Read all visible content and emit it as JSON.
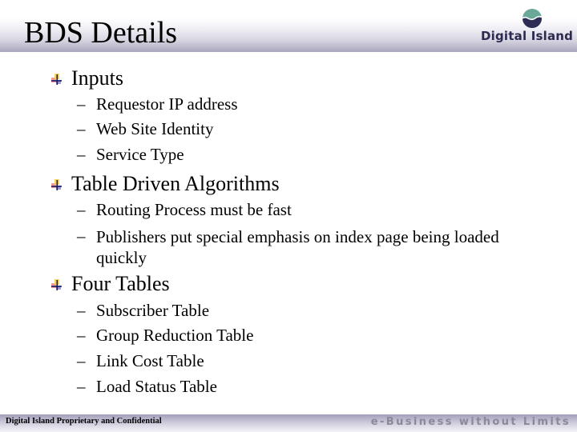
{
  "slide": {
    "title": "BDS Details",
    "logo": {
      "text": "Digital Island",
      "icon": "digital-island-globe-icon",
      "colors": {
        "top": "#6aa898",
        "bottom": "#2e2c55",
        "text": "#2b2a4f"
      }
    },
    "bullets": [
      {
        "label": "Inputs",
        "icon": "bullet-cross-icon",
        "items": [
          "Requestor IP address",
          "Web Site Identity",
          "Service Type"
        ]
      },
      {
        "label": "Table Driven Algorithms",
        "icon": "bullet-cross-icon",
        "items": [
          "Routing Process must be fast",
          "Publishers put special emphasis on index page being loaded quickly"
        ]
      },
      {
        "label": "Four Tables",
        "icon": "bullet-cross-icon",
        "items": [
          "Subscriber Table",
          "Group Reduction Table",
          "Link Cost Table",
          "Load Status Table"
        ]
      }
    ],
    "dash": "–",
    "footer": {
      "left": "Digital Island Proprietary and Confidential",
      "right": "e-Business without Limits"
    },
    "colors": {
      "band": "#a8a5bd",
      "footer_text": "#8a8899"
    }
  }
}
